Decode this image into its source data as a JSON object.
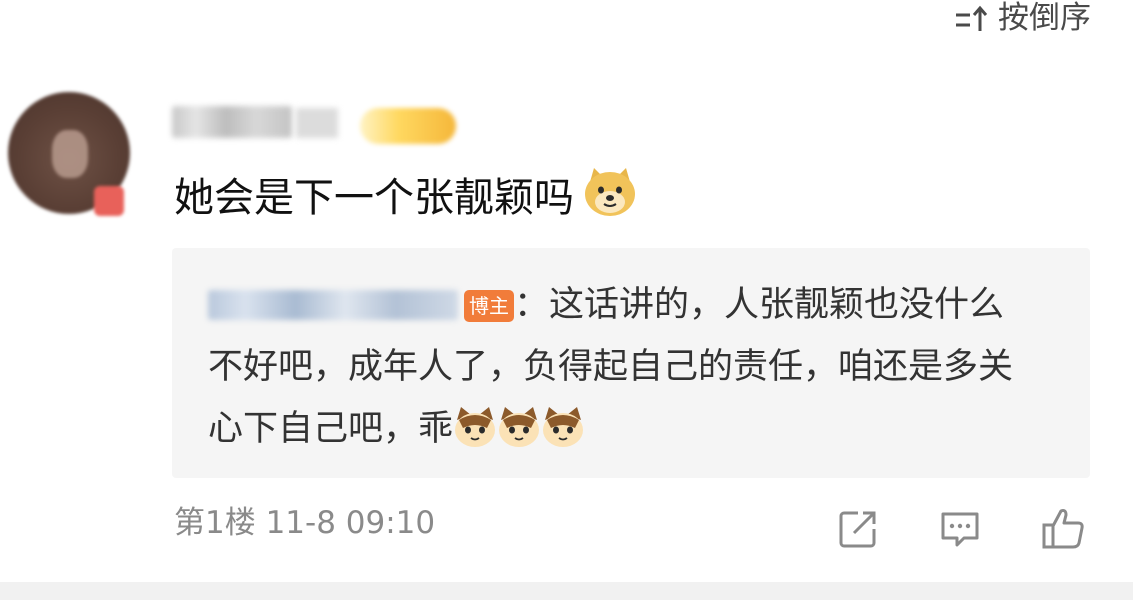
{
  "sort": {
    "label": "按倒序",
    "icon": "sort-order-icon"
  },
  "comment": {
    "text": "她会是下一个张靓颖吗",
    "emoji": "doge-emoji"
  },
  "reply": {
    "tag": "博主",
    "text": "：这话讲的，人张靓颖也没什么不好吧，成年人了，负得起自己的责任，咱还是多关心下自己吧，乖",
    "emojis": [
      "cat-emoji",
      "cat-emoji",
      "cat-emoji"
    ]
  },
  "footer": {
    "meta": "第1楼 11-8 09:10",
    "actions": [
      "share-icon",
      "comment-icon",
      "like-icon"
    ]
  },
  "colors": {
    "text_primary": "#111111",
    "text_secondary": "#8a8a8a",
    "reply_bg": "#f5f5f5",
    "blogger_tag": "#f17c3a"
  }
}
